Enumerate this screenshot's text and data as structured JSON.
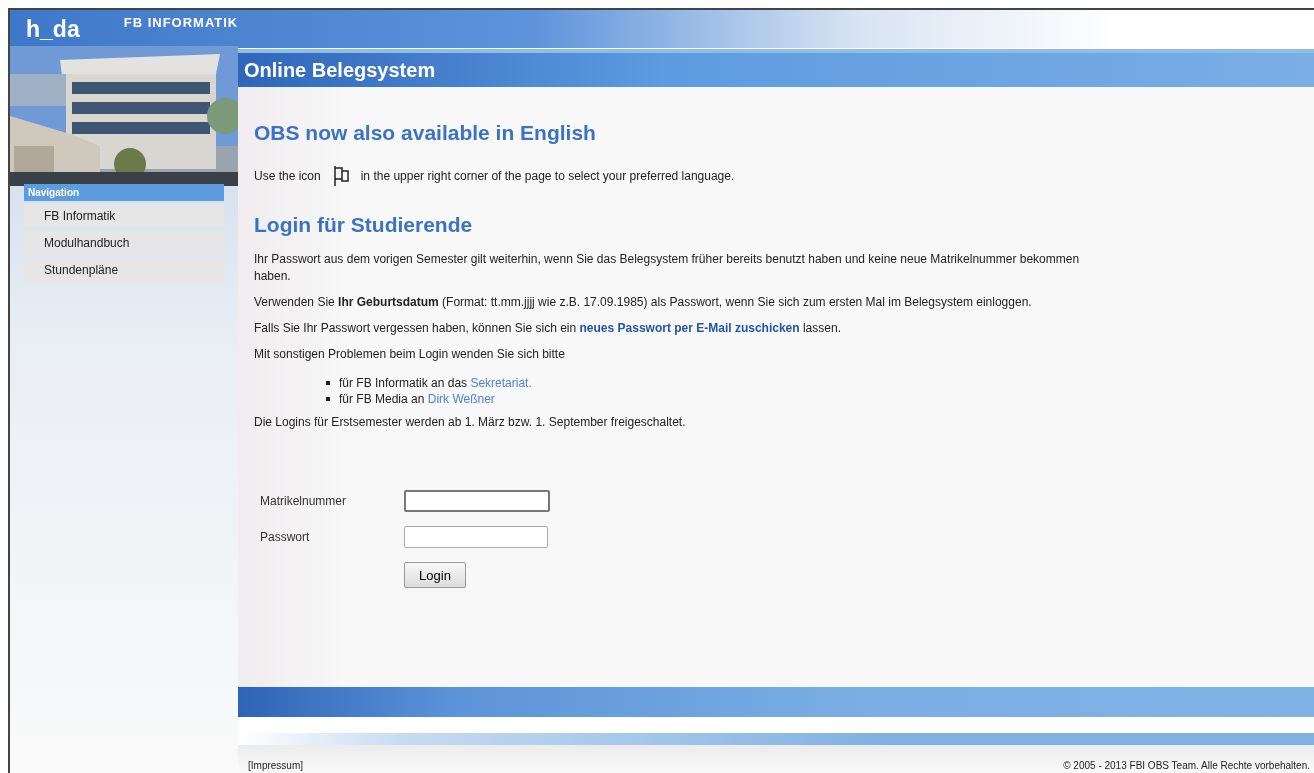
{
  "header": {
    "logo": "h_da",
    "department": "FB INFORMATIK"
  },
  "navigation": {
    "title": "Navigation",
    "items": [
      {
        "label": "FB Informatik"
      },
      {
        "label": "Modulhandbuch"
      },
      {
        "label": "Stundenpläne"
      }
    ]
  },
  "page_title": "Online Belegsystem",
  "sections": [
    {
      "heading": "OBS now also available in English",
      "icon_line": {
        "before": "Use the icon",
        "after": "in the upper right corner of the page to select your preferred language."
      }
    },
    {
      "heading": "Login für Studierende",
      "paragraphs": [
        [
          {
            "kind": "text",
            "text": "Ihr Passwort aus dem vorigen Semester gilt weiterhin, wenn Sie das Belegsystem früher bereits benutzt haben und keine neue Matrikelnummer bekommen haben."
          }
        ],
        [
          {
            "kind": "text",
            "text": "Verwenden Sie **Ihr Geburtsdatum** (Format: tt.mm.jjjj wie z.B. 17.09.1985) als Passwort, wenn Sie sich zum ersten Mal im Belegsystem einloggen."
          }
        ],
        [
          {
            "kind": "text",
            "text": "Falls Sie Ihr Passwort vergessen haben, können Sie sich ein"
          },
          {
            "kind": "boldlink",
            "text": "neues Passwort per E-Mail zuschicken"
          },
          {
            "kind": "text",
            "text": "lassen."
          }
        ],
        [
          {
            "kind": "text",
            "text": "Mit sonstigen Problemen beim Login wenden Sie sich bitte"
          }
        ]
      ],
      "contacts": [
        [
          {
            "kind": "text",
            "text": "für FB Informatik an das"
          },
          {
            "kind": "link",
            "text": "Sekretariat."
          }
        ],
        [
          {
            "kind": "text",
            "text": "für FB Media an"
          },
          {
            "kind": "link",
            "text": "Dirk Weßner"
          }
        ]
      ],
      "note": "Die Logins für Erstsemester werden ab 1. März bzw. 1. September freigeschaltet."
    }
  ],
  "form": {
    "fields": [
      {
        "label": "Matrikelnummer",
        "focused": true
      },
      {
        "label": "Passwort",
        "focused": false
      }
    ],
    "button": "Login"
  },
  "footer": {
    "impressum": "[Impressum]",
    "copyright": "© 2005 - 2013 FBI OBS Team. Alle Rechte vorbehalten."
  }
}
